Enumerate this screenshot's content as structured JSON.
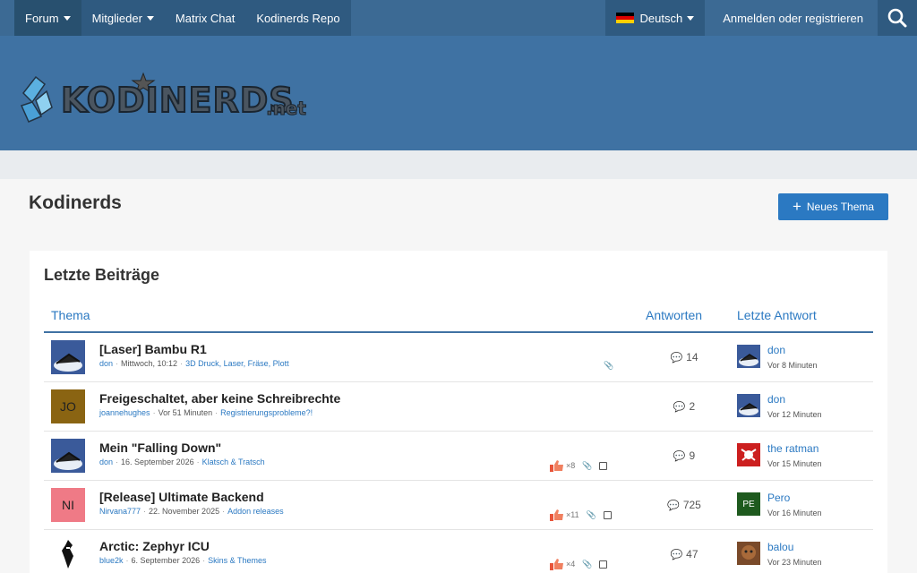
{
  "nav": {
    "items": [
      {
        "label": "Forum",
        "dropdown": true,
        "active": true
      },
      {
        "label": "Mitglieder",
        "dropdown": true,
        "active": false
      },
      {
        "label": "Matrix Chat",
        "dropdown": false,
        "active": false
      },
      {
        "label": "Kodinerds Repo",
        "dropdown": false,
        "active": false
      }
    ],
    "language": "Deutsch",
    "login": "Anmelden oder registrieren",
    "search_icon": "search-icon"
  },
  "header": {
    "logo_text": "KODINERDS",
    "logo_suffix": ".net"
  },
  "page": {
    "title": "Kodinerds",
    "new_topic_label": "Neues Thema"
  },
  "box": {
    "title": "Letzte Beiträge",
    "columns": [
      "Thema",
      "Antworten",
      "Letzte Antwort"
    ]
  },
  "topics": [
    {
      "title": "[Laser] Bambu R1",
      "author": "don",
      "date": "Mittwoch, 10:12",
      "board": "3D Druck, Laser, Fräse, Plott",
      "likes": "",
      "attachment": true,
      "replies": "14",
      "last_user": "don",
      "last_time": "Vor 8 Minuten",
      "avatar_text": "",
      "avatar_color": "#3a5a9a",
      "last_avatar_text": "",
      "last_avatar_color": "#3a5a9a"
    },
    {
      "title": "Freigeschaltet, aber keine Schreibrechte",
      "author": "joannehughes",
      "date": "Vor 51 Minuten",
      "board": "Registrierungsprobleme?!",
      "likes": "",
      "attachment": false,
      "replies": "2",
      "last_user": "don",
      "last_time": "Vor 12 Minuten",
      "avatar_text": "JO",
      "avatar_color": "#8a6412",
      "last_avatar_text": "",
      "last_avatar_color": "#3a5a9a"
    },
    {
      "title": "Mein \"Falling Down\"",
      "author": "don",
      "date": "16. September 2026",
      "board": "Klatsch & Tratsch",
      "likes": "×8",
      "attachment": true,
      "replies": "9",
      "last_user": "the ratman",
      "last_time": "Vor 15 Minuten",
      "avatar_text": "",
      "avatar_color": "#3a5a9a",
      "last_avatar_text": "",
      "last_avatar_color": "#cc1f1f"
    },
    {
      "title": "[Release] Ultimate Backend",
      "author": "Nirvana777",
      "date": "22. November 2025",
      "board": "Addon releases",
      "likes": "×11",
      "attachment": true,
      "replies": "725",
      "last_user": "Pero",
      "last_time": "Vor 16 Minuten",
      "avatar_text": "NI",
      "avatar_color": "#ef7a86",
      "last_avatar_text": "PE",
      "last_avatar_color": "#1e5a1e"
    },
    {
      "title": "Arctic: Zephyr ICU",
      "author": "blue2k",
      "date": "6. September 2026",
      "board": "Skins & Themes",
      "likes": "×4",
      "attachment": true,
      "replies": "47",
      "last_user": "balou",
      "last_time": "Vor 23 Minuten",
      "avatar_text": "",
      "avatar_color": "#ffffff",
      "last_avatar_text": "",
      "last_avatar_color": "#7a4a2a"
    }
  ],
  "colors": {
    "nav_bg": "#3c6a94",
    "header_bg": "#3f72a3",
    "accent": "#2b79c2"
  }
}
